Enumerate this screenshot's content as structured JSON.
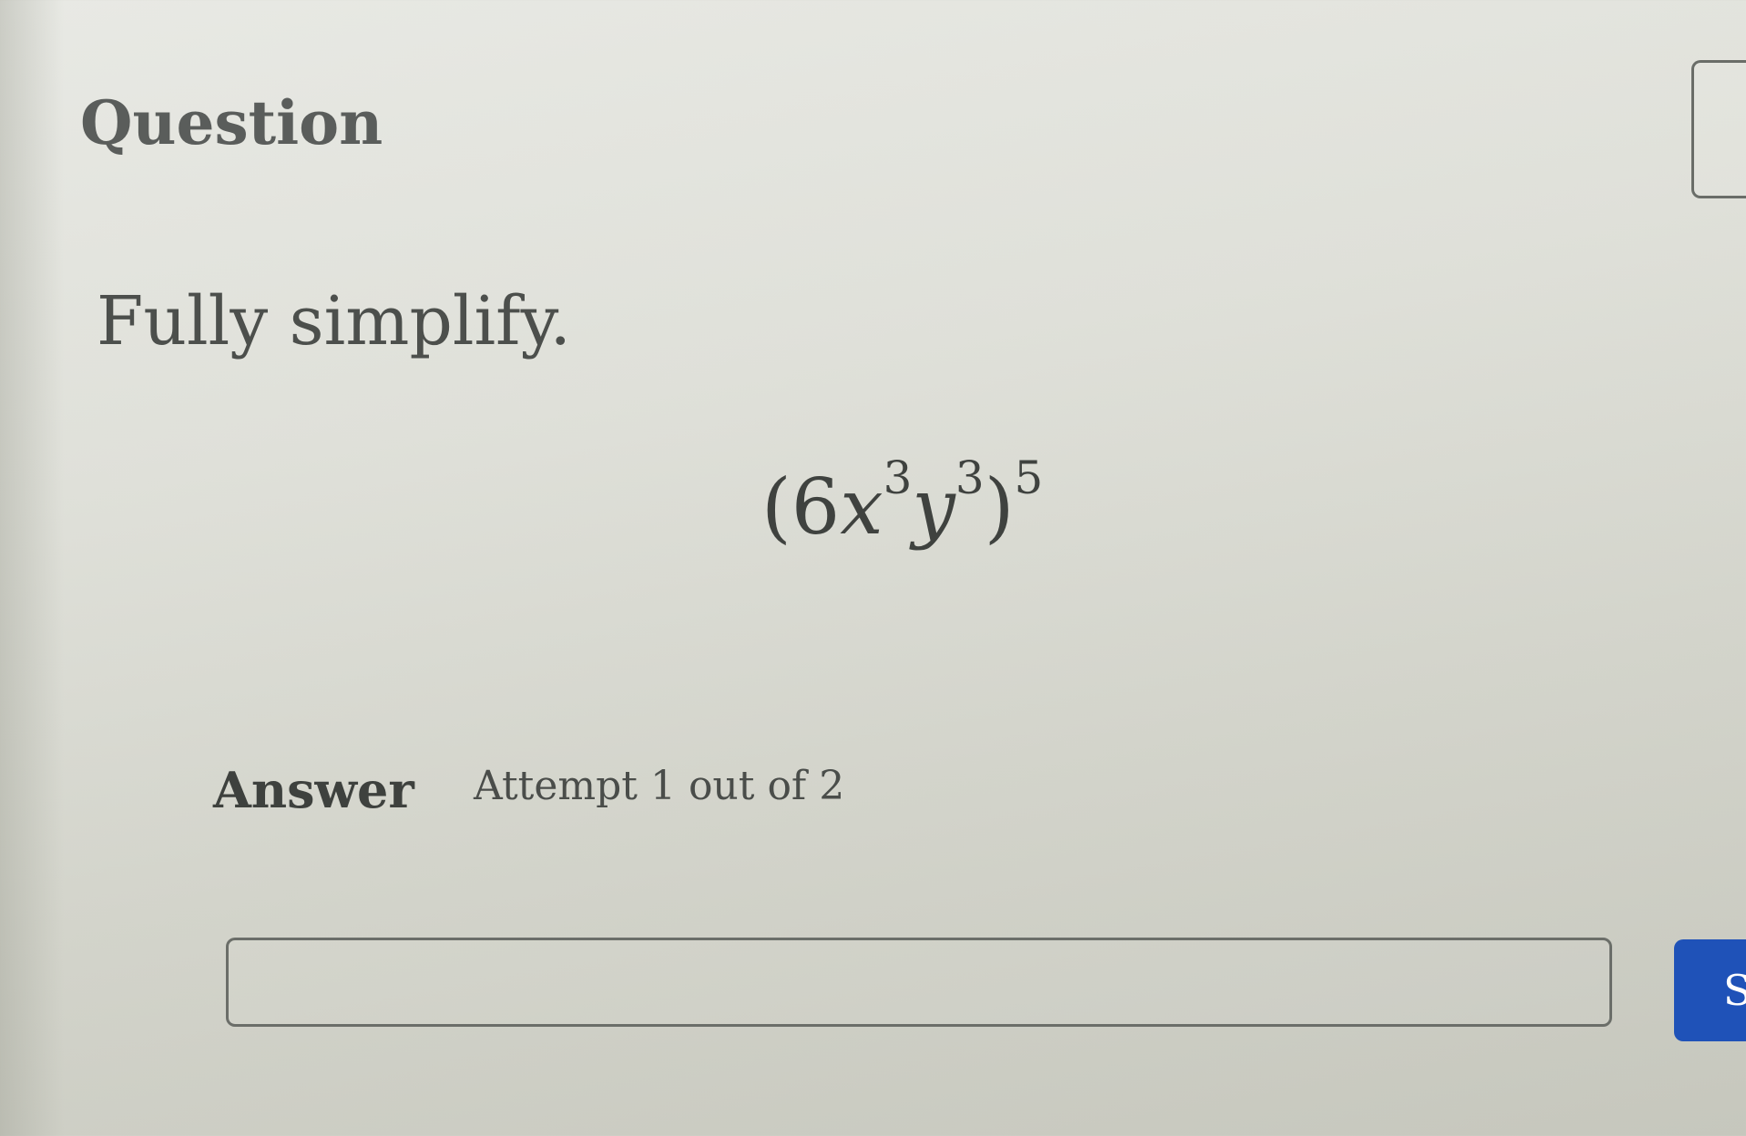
{
  "question": {
    "title": "Question",
    "instruction": "Fully simplify."
  },
  "expression": {
    "open_paren": "(",
    "coefficient": "6",
    "var_x": "x",
    "exp_x": "3",
    "var_y": "y",
    "exp_y": "3",
    "close_paren": ")",
    "outer_exp": "5"
  },
  "answer": {
    "label": "Answer",
    "attempt": "Attempt 1 out of 2",
    "input_value": ""
  },
  "submit": {
    "label_partial": "S"
  },
  "colors": {
    "submit_bg": "#1f52b8",
    "text": "#4f524f"
  }
}
